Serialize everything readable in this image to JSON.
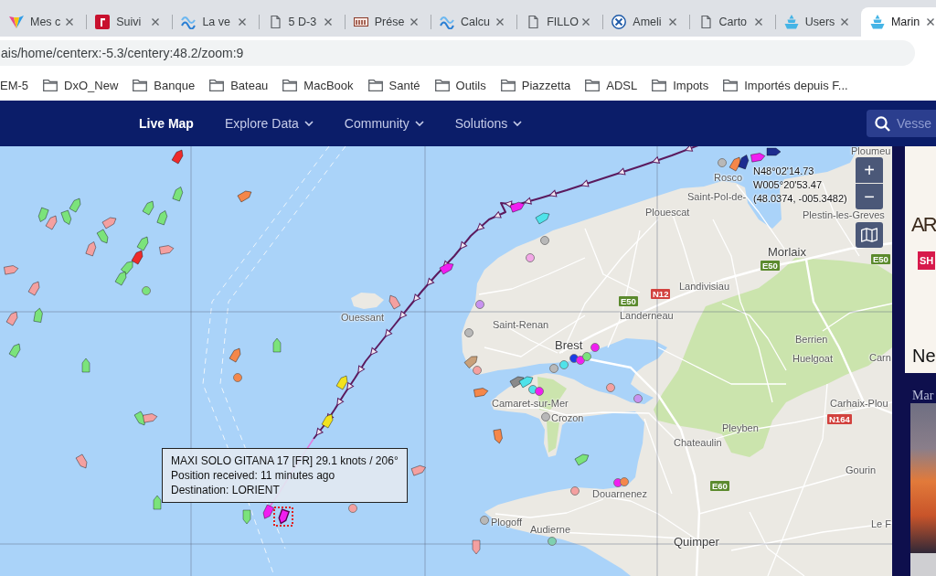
{
  "browser": {
    "tabs": [
      {
        "title": "Mes c",
        "kind": "site",
        "selected": false
      },
      {
        "title": "Suivi",
        "kind": "site",
        "selected": false
      },
      {
        "title": "La ve",
        "kind": "site",
        "selected": false
      },
      {
        "title": "5 D-3",
        "kind": "page",
        "selected": false
      },
      {
        "title": "Prése",
        "kind": "site",
        "selected": false
      },
      {
        "title": "Calcu",
        "kind": "site",
        "selected": false
      },
      {
        "title": "FILLO",
        "kind": "page",
        "selected": false
      },
      {
        "title": "Ameli",
        "kind": "site",
        "selected": false
      },
      {
        "title": "Carto",
        "kind": "page",
        "selected": false
      },
      {
        "title": "Users",
        "kind": "site",
        "selected": false
      },
      {
        "title": "Marin",
        "kind": "site",
        "selected": true
      }
    ],
    "address": "ais/home/centerx:-5.3/centery:48.2/zoom:9",
    "bookmarks": [
      {
        "label": "EM-5",
        "folder": false
      },
      {
        "label": "DxO_New",
        "folder": true
      },
      {
        "label": "Banque",
        "folder": true
      },
      {
        "label": "Bateau",
        "folder": true
      },
      {
        "label": "MacBook",
        "folder": true
      },
      {
        "label": "Santé",
        "folder": true
      },
      {
        "label": "Outils",
        "folder": true
      },
      {
        "label": "Piazzetta",
        "folder": true
      },
      {
        "label": "ADSL",
        "folder": true
      },
      {
        "label": "Impots",
        "folder": true
      },
      {
        "label": "Importés depuis F...",
        "folder": true
      }
    ]
  },
  "nav": {
    "items": [
      {
        "label": "Live Map",
        "selected": true,
        "dropdown": false
      },
      {
        "label": "Explore Data",
        "selected": false,
        "dropdown": true
      },
      {
        "label": "Community",
        "selected": false,
        "dropdown": true
      },
      {
        "label": "Solutions",
        "selected": false,
        "dropdown": true
      }
    ],
    "search": {
      "placeholder": "Vesse"
    }
  },
  "map": {
    "places": [
      {
        "name": "Ploumeu",
        "kind": "town"
      },
      {
        "name": "Rosco",
        "kind": "town"
      },
      {
        "name": "Saint-Pol-de-",
        "kind": "town"
      },
      {
        "name": "Plouescat",
        "kind": "town"
      },
      {
        "name": "Plestin-les-Greves",
        "kind": "town"
      },
      {
        "name": "Morlaix",
        "kind": "city"
      },
      {
        "name": "Landivisiau",
        "kind": "town"
      },
      {
        "name": "Ouessant",
        "kind": "town"
      },
      {
        "name": "Landerneau",
        "kind": "town"
      },
      {
        "name": "Saint-Renan",
        "kind": "town"
      },
      {
        "name": "Brest",
        "kind": "city"
      },
      {
        "name": "Berrien",
        "kind": "town"
      },
      {
        "name": "Huelgoat",
        "kind": "town"
      },
      {
        "name": "Carn",
        "kind": "town"
      },
      {
        "name": "Carhaix-Plou",
        "kind": "town"
      },
      {
        "name": "Camaret-sur-Mer",
        "kind": "town"
      },
      {
        "name": "Crozon",
        "kind": "town"
      },
      {
        "name": "Pleyben",
        "kind": "town"
      },
      {
        "name": "Chateaulin",
        "kind": "town"
      },
      {
        "name": "Gourin",
        "kind": "town"
      },
      {
        "name": "Douarnenez",
        "kind": "town"
      },
      {
        "name": "Plogoff",
        "kind": "town"
      },
      {
        "name": "Audierne",
        "kind": "town"
      },
      {
        "name": "Le F",
        "kind": "town"
      },
      {
        "name": "Quimper",
        "kind": "city"
      }
    ],
    "road_signs": [
      {
        "label": "E50",
        "color": "#5b8a2d"
      },
      {
        "label": "E50",
        "color": "#5b8a2d"
      },
      {
        "label": "E50",
        "color": "#5b8a2d"
      },
      {
        "label": "N12",
        "color": "#d2423e"
      },
      {
        "label": "N164",
        "color": "#d2423e"
      },
      {
        "label": "E60",
        "color": "#5b8a2d"
      }
    ],
    "vessels": [
      {
        "kind": "ship",
        "color": "#7be37b",
        "selected": false
      },
      {
        "kind": "ship",
        "color": "#f4a0a0",
        "selected": false
      },
      {
        "kind": "ship",
        "color": "#7be37b",
        "selected": false
      },
      {
        "kind": "ship",
        "color": "#7be37b",
        "selected": false
      },
      {
        "kind": "ship",
        "color": "#7be37b",
        "selected": false
      },
      {
        "kind": "ship",
        "color": "#7be37b",
        "selected": false
      },
      {
        "kind": "ship",
        "color": "#7be37b",
        "selected": false
      },
      {
        "kind": "ship",
        "color": "#f4a0a0",
        "selected": false
      },
      {
        "kind": "ship",
        "color": "#7be37b",
        "selected": false
      },
      {
        "kind": "ship",
        "color": "#ee2a2a",
        "selected": false
      },
      {
        "kind": "ship",
        "color": "#7be37b",
        "selected": false
      },
      {
        "kind": "ship",
        "color": "#7be37b",
        "selected": false
      },
      {
        "kind": "ship",
        "color": "#7be37b",
        "selected": false
      },
      {
        "kind": "ship",
        "color": "#f4a0a0",
        "selected": false
      },
      {
        "kind": "ship",
        "color": "#f4a0a0",
        "selected": false
      },
      {
        "kind": "ship",
        "color": "#f4a0a0",
        "selected": false
      },
      {
        "kind": "ship",
        "color": "#f4a0a0",
        "selected": false
      },
      {
        "kind": "ship",
        "color": "#7be37b",
        "selected": false
      },
      {
        "kind": "ship",
        "color": "#f4a0a0",
        "selected": false
      },
      {
        "kind": "ship",
        "color": "#7be37b",
        "selected": false
      },
      {
        "kind": "ship",
        "color": "#7be37b",
        "selected": false
      },
      {
        "kind": "dot",
        "color": "#7be37b",
        "selected": false
      },
      {
        "kind": "ship",
        "color": "#ee2a2a",
        "selected": false
      },
      {
        "kind": "ship",
        "color": "#f5874a",
        "selected": false
      },
      {
        "kind": "ship",
        "color": "#f5874a",
        "selected": false
      },
      {
        "kind": "dot",
        "color": "#f5874a",
        "selected": false
      },
      {
        "kind": "ship",
        "color": "#7be37b",
        "selected": false
      },
      {
        "kind": "ship",
        "color": "#7be37b",
        "selected": false
      },
      {
        "kind": "ship",
        "color": "#f4a0a0",
        "selected": false
      },
      {
        "kind": "ship",
        "color": "#f4a0a0",
        "selected": false
      },
      {
        "kind": "ship",
        "color": "#7be37b",
        "selected": false
      },
      {
        "kind": "ship",
        "color": "#7be37b",
        "selected": false
      },
      {
        "kind": "ship",
        "color": "#f4a0a0",
        "selected": false
      },
      {
        "kind": "dot",
        "color": "#f4a0a0",
        "selected": false
      },
      {
        "kind": "ship",
        "color": "#f4a0a0",
        "selected": false
      },
      {
        "kind": "ship",
        "color": "#f2e21f",
        "selected": false
      },
      {
        "kind": "ship",
        "color": "#f2e21f",
        "selected": false
      },
      {
        "kind": "ship",
        "color": "#f01ef0",
        "selected": false
      },
      {
        "kind": "ship",
        "color": "#f01ef0",
        "selected": true
      },
      {
        "kind": "ship",
        "color": "#f01ef0",
        "selected": false
      },
      {
        "kind": "ship",
        "color": "#f01ef0",
        "selected": false
      },
      {
        "kind": "ship",
        "color": "#4fe3ea",
        "selected": false
      },
      {
        "kind": "dot",
        "color": "#f2a6e6",
        "selected": false
      },
      {
        "kind": "dot",
        "color": "#b8b8b8",
        "selected": false
      },
      {
        "kind": "dot",
        "color": "#c892f0",
        "selected": false
      },
      {
        "kind": "dot",
        "color": "#b8b8b8",
        "selected": false
      },
      {
        "kind": "ship",
        "color": "#f4a0a0",
        "selected": false
      },
      {
        "kind": "ship",
        "color": "#f5874a",
        "selected": false
      },
      {
        "kind": "ship",
        "color": "#8a8a8a",
        "selected": false
      },
      {
        "kind": "ship",
        "color": "#4fe3ea",
        "selected": false
      },
      {
        "kind": "dot",
        "color": "#4fe3ea",
        "selected": false
      },
      {
        "kind": "dot",
        "color": "#f01ef0",
        "selected": false
      },
      {
        "kind": "dot",
        "color": "#b8b8b8",
        "selected": false
      },
      {
        "kind": "dot",
        "color": "#c892f0",
        "selected": false
      },
      {
        "kind": "ship",
        "color": "#f5874a",
        "selected": false
      },
      {
        "kind": "ship",
        "color": "#7be37b",
        "selected": false
      },
      {
        "kind": "dot",
        "color": "#f01ef0",
        "selected": false
      },
      {
        "kind": "dot",
        "color": "#f5874a",
        "selected": false
      },
      {
        "kind": "dot",
        "color": "#b8b8b8",
        "selected": false
      },
      {
        "kind": "dot",
        "color": "#7fd0b0",
        "selected": false
      },
      {
        "kind": "dot",
        "color": "#1a3ee6",
        "selected": false
      },
      {
        "kind": "dot",
        "color": "#f01ef0",
        "selected": false
      },
      {
        "kind": "dot",
        "color": "#7be37b",
        "selected": false
      },
      {
        "kind": "dot",
        "color": "#f01ef0",
        "selected": false
      },
      {
        "kind": "dot",
        "color": "#4fe3ea",
        "selected": false
      },
      {
        "kind": "dot",
        "color": "#b8b8b8",
        "selected": false
      },
      {
        "kind": "dot",
        "color": "#b8b8b8",
        "selected": false
      },
      {
        "kind": "ship",
        "color": "#f5874a",
        "selected": false
      },
      {
        "kind": "ship",
        "color": "#1d2c8f",
        "selected": false
      },
      {
        "kind": "ship",
        "color": "#f01ef0",
        "selected": false
      },
      {
        "kind": "ship",
        "color": "#1d2c8f",
        "selected": false
      },
      {
        "kind": "ship",
        "color": "#c8a07a",
        "selected": false
      },
      {
        "kind": "dot",
        "color": "#f4a0a0",
        "selected": false
      },
      {
        "kind": "dot",
        "color": "#f4a0a0",
        "selected": false
      },
      {
        "kind": "dot",
        "color": "#f4a0a0",
        "selected": false
      }
    ],
    "zoom_controls": [
      "+",
      "−"
    ],
    "position_readout": [
      "N48°02'14.73",
      "W005°20'53.47",
      "(48.0374, -005.3482)"
    ],
    "tooltip": {
      "lines": [
        "MAXI SOLO GITANA 17 [FR] 29.1 knots / 206°",
        "Position received: 11 minutes ago",
        "Destination: LORIENT"
      ]
    }
  },
  "ad": {
    "headline": "AR",
    "button": "SH",
    "tagline": "Ne",
    "caption": "Mar"
  }
}
